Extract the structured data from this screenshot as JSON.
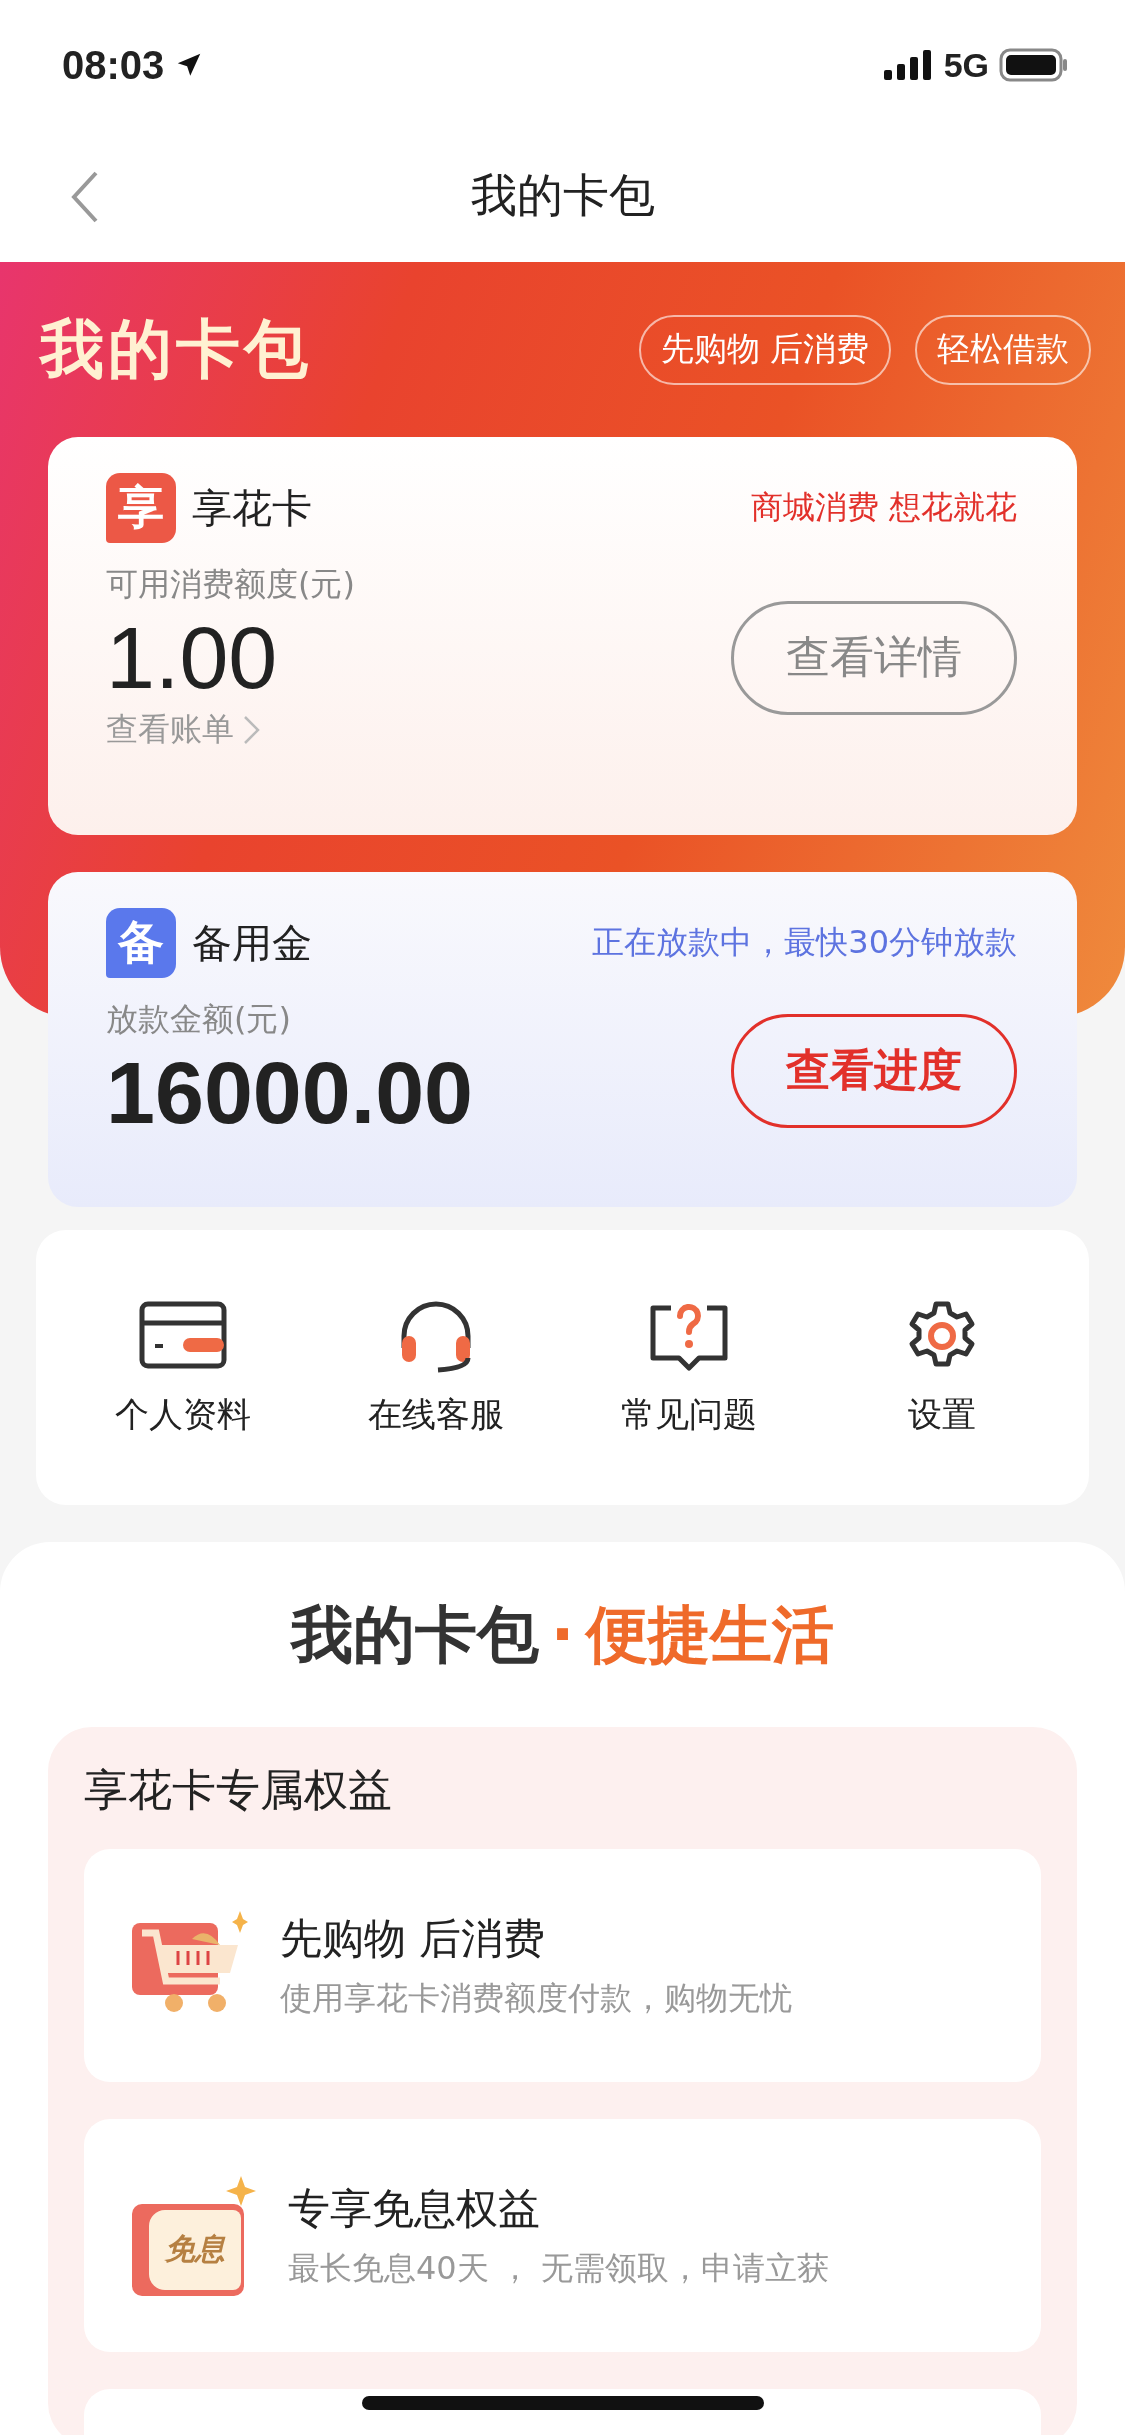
{
  "status_bar": {
    "time": "08:03",
    "network": "5G"
  },
  "nav": {
    "title": "我的卡包"
  },
  "header": {
    "logo": "我的卡包",
    "pills": [
      "先购物 后消费",
      "轻松借款"
    ]
  },
  "cards": [
    {
      "kind": "credit",
      "icon_char": "享",
      "name": "享花卡",
      "tagline": "商城消费 想花就花",
      "amount_label": "可用消费额度(元)",
      "amount": "1.00",
      "link": "查看账单",
      "button": "查看详情"
    },
    {
      "kind": "loan",
      "icon_char": "备",
      "name": "备用金",
      "tagline": "正在放款中，最快30分钟放款",
      "amount_label": "放款金额(元)",
      "amount": "16000.00",
      "button": "查看进度"
    }
  ],
  "shortcuts": [
    {
      "kind": "card",
      "label": "个人资料"
    },
    {
      "kind": "headset",
      "label": "在线客服"
    },
    {
      "kind": "question",
      "label": "常见问题"
    },
    {
      "kind": "gear",
      "label": "设置"
    }
  ],
  "slogan": {
    "main": "我的卡包",
    "dot": "·",
    "accent": "便捷生活"
  },
  "benefits": {
    "title": "享花卡专属权益",
    "items": [
      {
        "kind": "cart",
        "title": "先购物 后消费",
        "desc": "使用享花卡消费额度付款，购物无忧"
      },
      {
        "kind": "interest_free",
        "badge": "免息",
        "title": "专享免息权益",
        "desc": "最长免息40天 ， 无需领取，申请立获"
      }
    ]
  }
}
